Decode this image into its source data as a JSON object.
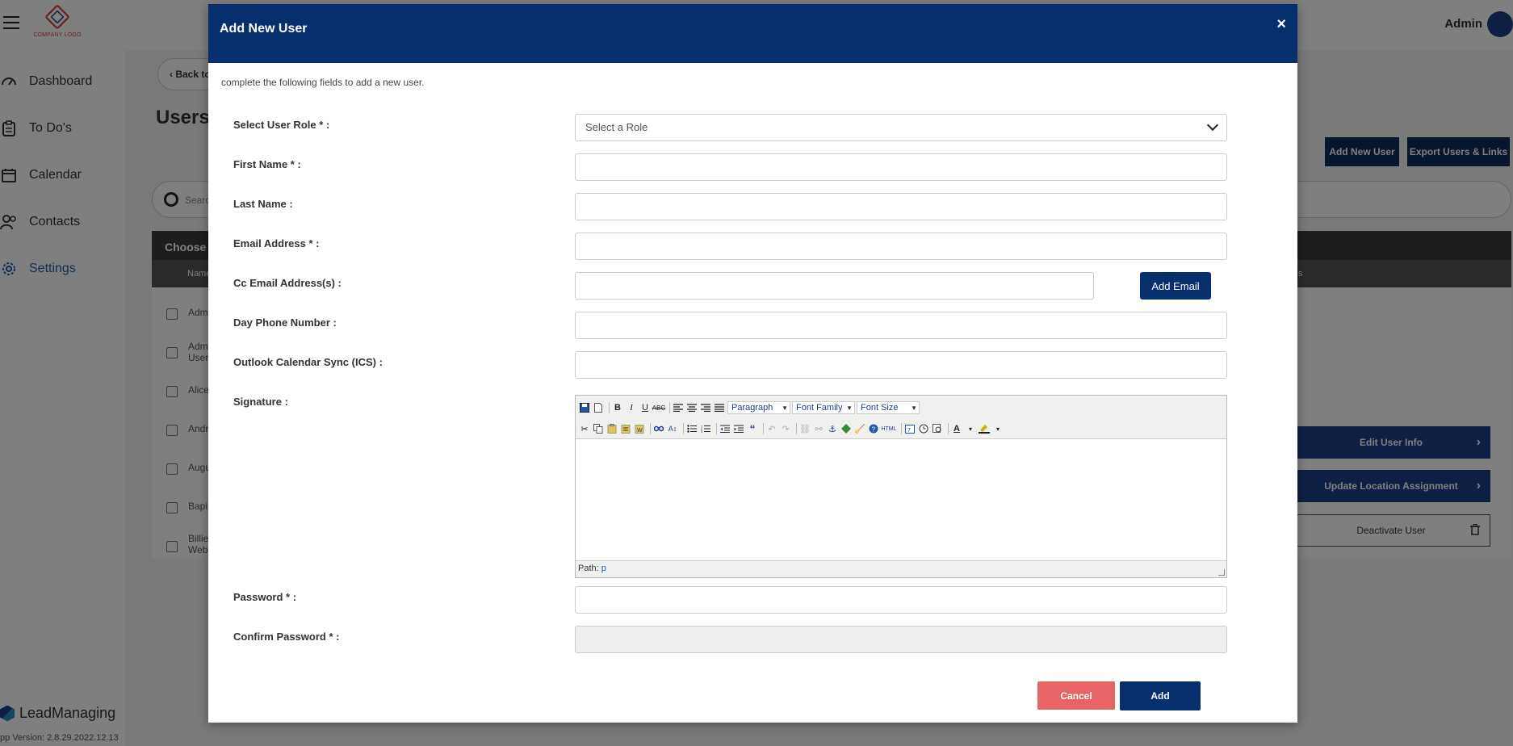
{
  "sidebar": {
    "logo_text": "COMPANY LOGO",
    "items": [
      {
        "label": "Dashboard"
      },
      {
        "label": "To Do's"
      },
      {
        "label": "Calendar"
      },
      {
        "label": "Contacts"
      },
      {
        "label": "Settings"
      }
    ],
    "brand": "LeadManaging",
    "version": "pp Version: 2.8.29.2022.12.13"
  },
  "topbar": {
    "user": "Admin"
  },
  "page": {
    "back_label": "Back to",
    "title": "Users",
    "add_new_user": "Add New User",
    "export_users": "Export Users & Links",
    "search_placeholder": "Search",
    "table_title": "Choose U",
    "col_name": "Name",
    "col_right": "s",
    "rows": [
      {
        "name": "Adm"
      },
      {
        "name": "Admi User"
      },
      {
        "name": "Alice"
      },
      {
        "name": "Andr"
      },
      {
        "name": "Augu"
      },
      {
        "name": "Bapi"
      },
      {
        "name": "Billie Webl"
      }
    ],
    "actions": {
      "edit": "Edit User Info",
      "location": "Update Location Assignment",
      "deactivate": "Deactivate User"
    }
  },
  "modal": {
    "title": "Add New User",
    "close": "×",
    "intro": "complete the following fields to add a new user.",
    "fields": {
      "role_label": "Select User Role * :",
      "role_value": "Select a Role",
      "first_name_label": "First Name * :",
      "last_name_label": "Last Name :",
      "email_label": "Email Address * :",
      "cc_label": "Cc Email Address(s) :",
      "add_email": "Add Email",
      "phone_label": "Day Phone Number :",
      "ics_label": "Outlook Calendar Sync (ICS) :",
      "signature_label": "Signature :",
      "password_label": "Password * :",
      "confirm_label": "Confirm Password * :"
    },
    "editor": {
      "paragraph": "Paragraph",
      "font_family": "Font Family",
      "font_size": "Font Size",
      "path_label": "Path:",
      "path_value": "p"
    },
    "cancel": "Cancel",
    "add": "Add"
  },
  "colors": {
    "modal_header": "#062f6e",
    "cancel": "#e86464",
    "primary": "#062f6e",
    "accent": "#1f5fa8"
  }
}
